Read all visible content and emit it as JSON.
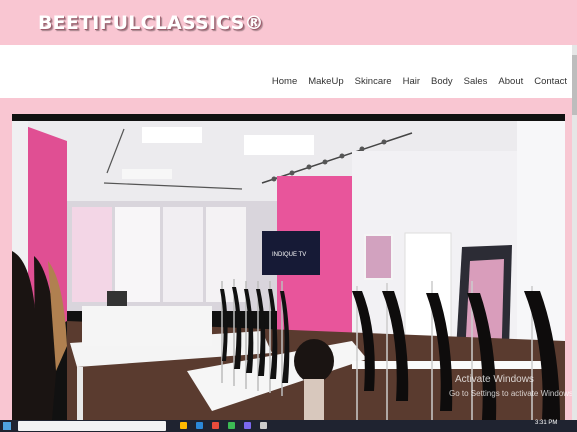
{
  "header": {
    "brand": "BEETIFULCLASSICS®"
  },
  "nav": {
    "items": [
      {
        "label": "Home"
      },
      {
        "label": "MakeUp"
      },
      {
        "label": "Skincare"
      },
      {
        "label": "Hair"
      },
      {
        "label": "Body"
      },
      {
        "label": "Sales"
      },
      {
        "label": "About"
      },
      {
        "label": "Contact"
      }
    ]
  },
  "hero": {
    "tv_text": "INDIQUE TV"
  },
  "watermark": {
    "line1": "Activate Windows",
    "line2": "Go to Settings to activate Windows."
  },
  "taskbar": {
    "time": "3:31 PM",
    "start_icon": "windows-icon",
    "search_icon": "search-icon"
  },
  "colors": {
    "brand_bar": "#f9c6d2",
    "pink_wall": "#e8559b",
    "accent": "#f9c6d2"
  }
}
